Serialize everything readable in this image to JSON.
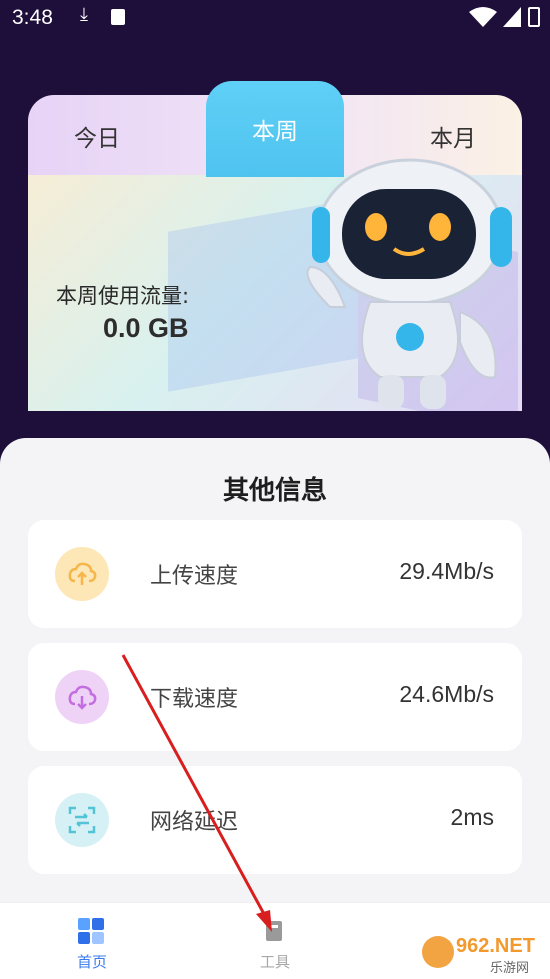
{
  "status_bar": {
    "time": "3:48"
  },
  "tabs": [
    {
      "label": "今日",
      "active": false
    },
    {
      "label": "本周",
      "active": true
    },
    {
      "label": "本月",
      "active": false
    }
  ],
  "usage": {
    "label": "本周使用流量:",
    "value": "0.0 GB"
  },
  "info": {
    "title": "其他信息",
    "rows": [
      {
        "label": "上传速度",
        "value": "29.4Mb/s",
        "icon": "cloud-upload-icon",
        "icon_bg": "#fde7b6",
        "icon_color": "#f5b64a"
      },
      {
        "label": "下载速度",
        "value": "24.6Mb/s",
        "icon": "cloud-download-icon",
        "icon_bg": "#efd3f7",
        "icon_color": "#c36ee0"
      },
      {
        "label": "网络延迟",
        "value": "2ms",
        "icon": "latency-scan-icon",
        "icon_bg": "#d6f1f5",
        "icon_color": "#55c3d6"
      }
    ]
  },
  "nav": {
    "items": [
      {
        "label": "首页",
        "icon": "home-grid-icon",
        "active": true
      },
      {
        "label": "工具",
        "icon": "tools-icon",
        "active": false
      }
    ]
  },
  "watermark": {
    "text": "962.NET",
    "sub": "乐游网"
  },
  "colors": {
    "background": "#1d0f3a",
    "active_tab": "#4fc3f0",
    "nav_active": "#3a7cf0",
    "annotation_arrow": "#d81e1e"
  }
}
